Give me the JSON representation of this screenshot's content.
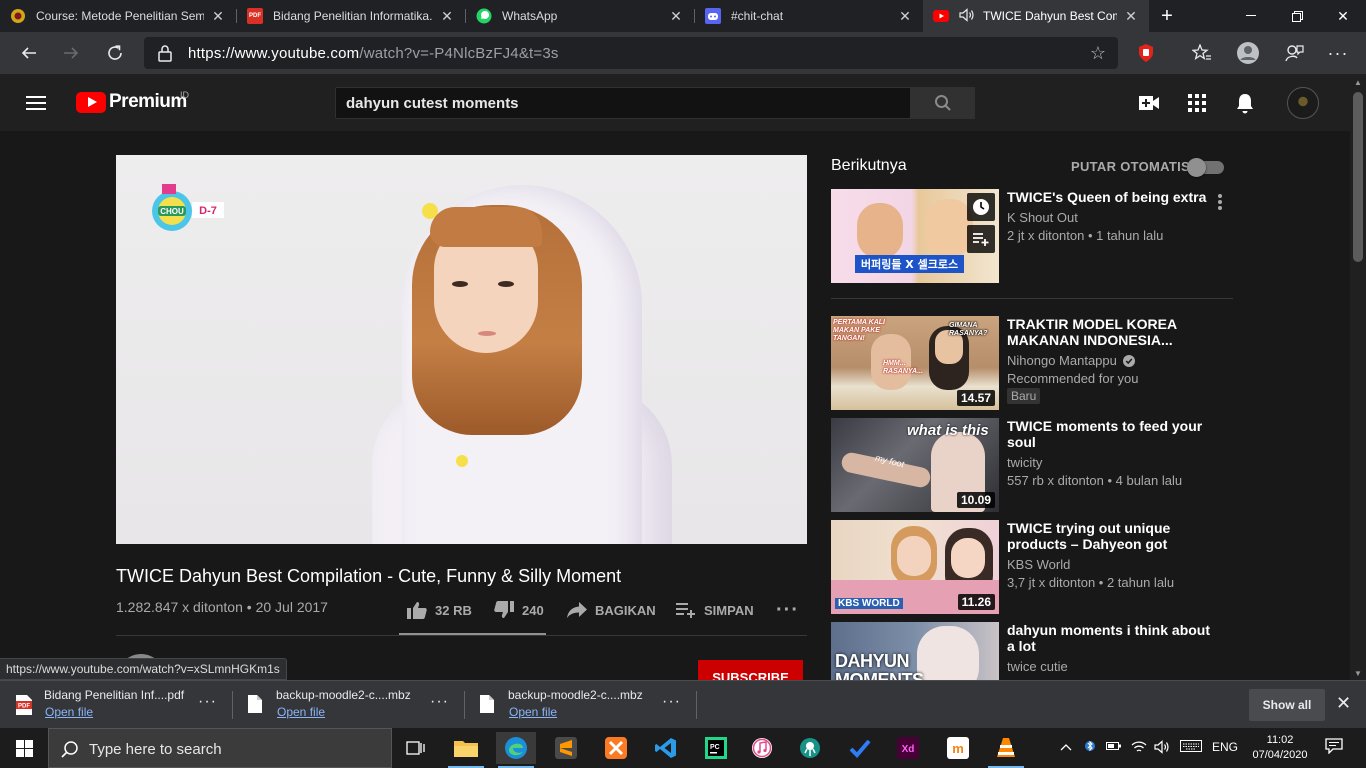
{
  "browser": {
    "tabs": [
      {
        "title": "Course: Metode Penelitian Sem",
        "icon": "moodle-icon"
      },
      {
        "title": "Bidang Penelitian Informatika.p",
        "icon": "pdf-icon"
      },
      {
        "title": "WhatsApp",
        "icon": "whatsapp-icon"
      },
      {
        "title": "#chit-chat",
        "icon": "discord-icon"
      },
      {
        "title": "TWICE Dahyun Best Comp",
        "icon": "youtube-icon",
        "active": true,
        "audio": true
      }
    ],
    "url_host": "https://www.youtube.com",
    "url_path": "/watch?v=-P4NlcBzFJ4&t=3s",
    "status_url": "https://www.youtube.com/watch?v=xSLmnHGKm1s"
  },
  "youtube": {
    "logo_text": "Premium",
    "country_code": "ID",
    "search_query": "dahyun cutest moments",
    "video": {
      "title": "TWICE Dahyun Best Compilation - Cute, Funny & Silly Moment",
      "views": "1.282.847 x ditonton",
      "date": "20 Jul 2017",
      "meta_sep": " • ",
      "likes": "32 RB",
      "dislikes": "240",
      "share_label": "BAGIKAN",
      "save_label": "SIMPAN",
      "overlay_badge": "D-7",
      "subscribe_label": "SUBSCRIBE"
    },
    "sidebar": {
      "up_next_label": "Berikutnya",
      "autoplay_label": "PUTAR OTOMATIS",
      "autoplay_on": false,
      "items": [
        {
          "title": "TWICE's Queen of being extra",
          "channel": "K Shout Out",
          "views": "2 jt x ditonton • 1 tahun lalu",
          "duration": "",
          "thumb_colors": [
            "#f3d6e6",
            "#c86a9a",
            "#2a6ed8"
          ]
        },
        {
          "title": "TRAKTIR MODEL KOREA MAKANAN INDONESIA...",
          "channel": "Nihongo Mantappu",
          "views": "Recommended for you",
          "badge": "Baru",
          "duration": "14.57",
          "verified": true,
          "thumb_colors": [
            "#b68e6a",
            "#e9c59c",
            "#4a3527"
          ]
        },
        {
          "title": "TWICE moments to feed your soul",
          "channel": "twicity",
          "views": "557 rb x ditonton • 4 bulan lalu",
          "duration": "10.09",
          "thumb_colors": [
            "#6a6a72",
            "#d7b6a4",
            "#2e2e34"
          ]
        },
        {
          "title": "TWICE trying out unique products – Dahyeon got doubl...",
          "channel": "KBS World",
          "views": "3,7 jt x ditonton • 2 tahun lalu",
          "duration": "11.26",
          "thumb_colors": [
            "#f1e0d0",
            "#e6a0b4",
            "#2b5fb0"
          ]
        },
        {
          "title": "dahyun moments i think about a lot",
          "channel": "twice cutie",
          "views": "",
          "duration": "",
          "thumb_colors": [
            "#7d8ea8",
            "#f0e4e2",
            "#2c3a55"
          ]
        }
      ],
      "thumb_texts": {
        "item1_caption": "버퍼링들 X 셀크로스",
        "item2_caption_a": "PERTAMA KALI MAKAN PAKE TANGAN!",
        "item2_caption_b": "GIMANA RASANYA?",
        "item2_caption_c": "HMM... RASANYA...",
        "item3_caption_a": "what is this",
        "item3_caption_b": "my foot",
        "item4_caption": "KBS WORLD",
        "item5_caption": "DAHYUN MOMENTS"
      }
    }
  },
  "downloads": {
    "items": [
      {
        "name": "Bidang Penelitian Inf....pdf",
        "type": "pdf"
      },
      {
        "name": "backup-moodle2-c....mbz",
        "type": "file"
      },
      {
        "name": "backup-moodle2-c....mbz",
        "type": "file"
      }
    ],
    "open_label": "Open file",
    "show_all_label": "Show all"
  },
  "taskbar": {
    "search_placeholder": "Type here to search",
    "apps": [
      "task-view",
      "file-explorer",
      "edge",
      "sublime-text",
      "xampp",
      "vscode",
      "pycharm",
      "itunes",
      "gitkraken",
      "ticktick",
      "adobe-xd",
      "moodle",
      "vlc"
    ],
    "language": "ENG",
    "time": "11:02",
    "date": "07/04/2020"
  },
  "colors": {
    "yt_red": "#ff0000",
    "subscribe_red": "#cc0000",
    "page_bg": "#181818",
    "link_blue": "#8ab4f8"
  }
}
